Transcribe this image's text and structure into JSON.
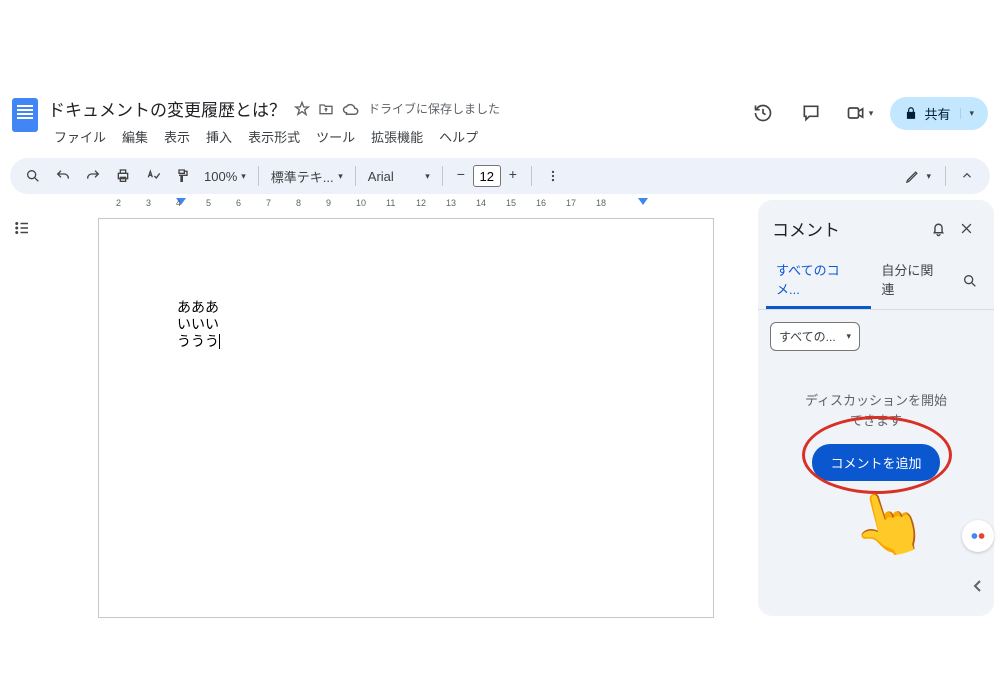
{
  "header": {
    "doc_title": "ドキュメントの変更履歴とは？",
    "save_status": "ドライブに保存しました",
    "menus": [
      "ファイル",
      "編集",
      "表示",
      "挿入",
      "表示形式",
      "ツール",
      "拡張機能",
      "ヘルプ"
    ],
    "share_label": "共有"
  },
  "toolbar": {
    "zoom": "100%",
    "style": "標準テキ...",
    "font": "Arial",
    "font_size": "12"
  },
  "ruler": {
    "marks": [
      2,
      3,
      4,
      5,
      6,
      7,
      8,
      9,
      10,
      11,
      12,
      13,
      14,
      15,
      16,
      17,
      18
    ]
  },
  "document": {
    "lines": [
      "あああ",
      "いいい",
      "ううう"
    ]
  },
  "comments": {
    "title": "コメント",
    "tab_all": "すべてのコメ...",
    "tab_mine": "自分に関連",
    "filter": "すべての...",
    "empty_line1": "ディスカッションを開始",
    "empty_line2": "できます",
    "add_button": "コメントを追加"
  }
}
